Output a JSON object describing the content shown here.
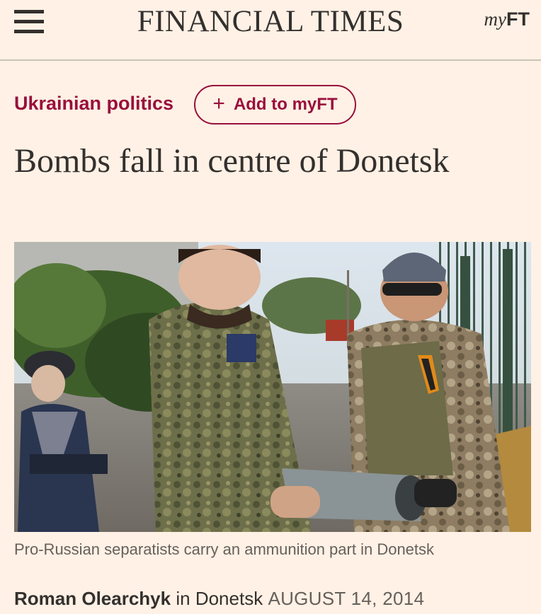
{
  "header": {
    "masthead": "FINANCIAL TIMES",
    "myft_prefix": "my",
    "myft_suffix": "FT"
  },
  "article": {
    "topic": "Ukrainian politics",
    "follow_button_label": "Add to myFT",
    "headline": "Bombs fall in centre of Donetsk",
    "image_caption": "Pro-Russian separatists carry an ammunition part in Donetsk",
    "byline": {
      "author": "Roman Olearchyk",
      "location_prefix": "in",
      "location": "Donetsk",
      "date": "AUGUST 14, 2014"
    }
  },
  "icons": {
    "menu": "hamburger-menu-icon",
    "follow": "plus-icon"
  },
  "colors": {
    "background": "#fff1e5",
    "text": "#33302e",
    "accent": "#990f3d",
    "muted": "#66605c",
    "divider": "#ccc1b7"
  }
}
